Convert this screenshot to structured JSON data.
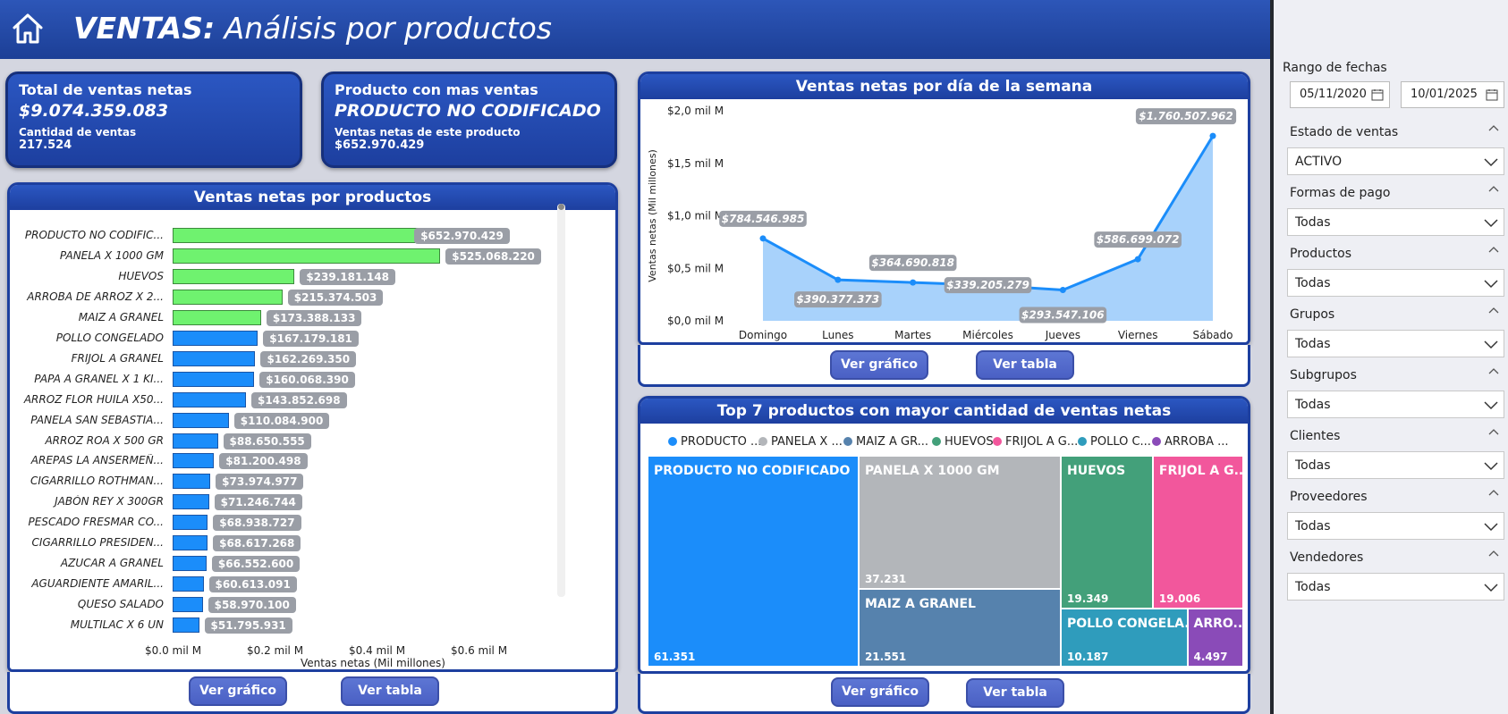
{
  "header": {
    "title_bold": "VENTAS:",
    "title_rest": " Análisis por productos"
  },
  "kpis": {
    "total": {
      "title": "Total de ventas netas",
      "value": "$9.074.359.083",
      "sub_label": "Cantidad de ventas",
      "sub_value": "217.524"
    },
    "top_product": {
      "title": "Producto con mas ventas",
      "value": "PRODUCTO NO CODIFICADO",
      "sub_label": "Ventas netas de este producto",
      "sub_value": "$652.970.429"
    }
  },
  "colors": {
    "header_blue": "#1d3f9f",
    "green": "#6ff26f",
    "blue": "#1b8dfa",
    "area": "#a8d2fb",
    "line": "#1b8dfa"
  },
  "product_panel": {
    "title": "Ventas netas por productos",
    "xlabel": "Ventas netas (Mil millones)",
    "ticks": [
      "$0.0 mil M",
      "$0.2 mil M",
      "$0.4 mil M",
      "$0.6 mil M"
    ],
    "buttons": [
      "Ver gráfico",
      "Ver tabla"
    ]
  },
  "chart_data": [
    {
      "type": "bar",
      "orientation": "horizontal",
      "title": "Ventas netas por productos",
      "xlabel": "Ventas netas (Mil millones)",
      "xlim": [
        0,
        0.6
      ],
      "categories": [
        "PRODUCTO NO CODIFIC...",
        "PANELA X 1000 GM",
        "HUEVOS",
        "ARROBA DE ARROZ X 2...",
        "MAIZ A GRANEL",
        "POLLO CONGELADO",
        "FRIJOL A GRANEL",
        "PAPA A GRANEL X 1 KI...",
        "ARROZ FLOR HUILA X50...",
        "PANELA SAN SEBASTIA...",
        "ARROZ ROA X 500 GR",
        "AREPAS LA ANSERMEÑ...",
        "CIGARRILLO ROTHMAN...",
        "JABÓN REY X 300GR",
        "PESCADO FRESMAR CO...",
        "CIGARRILLO PRESIDEN...",
        "AZUCAR A GRANEL",
        "AGUARDIENTE AMARIL...",
        "QUESO SALADO",
        "MULTILAC X 6 UN"
      ],
      "values": [
        652970429,
        525068220,
        239181148,
        215374503,
        173388133,
        167179181,
        162269350,
        160068390,
        143852698,
        110084900,
        88650555,
        81200498,
        73974977,
        71246744,
        68938727,
        68617268,
        66552600,
        60613091,
        58970100,
        51795931
      ],
      "value_labels": [
        "$652.970.429",
        "$525.068.220",
        "$239.181.148",
        "$215.374.503",
        "$173.388.133",
        "$167.179.181",
        "$162.269.350",
        "$160.068.390",
        "$143.852.698",
        "$110.084.900",
        "$88.650.555",
        "$81.200.498",
        "$73.974.977",
        "$71.246.744",
        "$68.938.727",
        "$68.617.268",
        "$66.552.600",
        "$60.613.091",
        "$58.970.100",
        "$51.795.931"
      ],
      "highlight_count": 5
    },
    {
      "type": "area",
      "title": "Ventas netas por día de la semana",
      "ylabel": "Ventas netas (Mil millones)",
      "ylim": [
        0,
        2.0
      ],
      "categories": [
        "Domingo",
        "Lunes",
        "Martes",
        "Miércoles",
        "Jueves",
        "Viernes",
        "Sábado"
      ],
      "values": [
        784546985,
        390377373,
        364690818,
        339205279,
        293547106,
        586699072,
        1760507962
      ],
      "value_labels": [
        "$784.546.985",
        "$390.377.373",
        "$364.690.818",
        "$339.205.279",
        "$293.547.106",
        "$586.699.072",
        "$1.760.507.962"
      ],
      "y_ticks": [
        "$2,0 mil M",
        "$1,5 mil M",
        "$1,0 mil M",
        "$0,5 mil M",
        "$0,0 mil M"
      ]
    },
    {
      "type": "treemap",
      "title": "Top 7 productos con mayor cantidad de ventas netas",
      "legend": [
        "PRODUCTO ...",
        "PANELA X ...",
        "MAIZ A GR...",
        "HUEVOS",
        "FRIJOL A G...",
        "POLLO C...",
        "ARROBA ..."
      ],
      "items": [
        {
          "name": "PRODUCTO NO CODIFICADO",
          "value": 61351,
          "label": "61.351",
          "color": "#1b8dfa"
        },
        {
          "name": "PANELA X 1000 GM",
          "value": 37231,
          "label": "37.231",
          "color": "#b3b6ba"
        },
        {
          "name": "MAIZ A GRANEL",
          "value": 21551,
          "label": "21.551",
          "color": "#5682ad"
        },
        {
          "name": "HUEVOS",
          "value": 19349,
          "label": "19.349",
          "color": "#43a07a"
        },
        {
          "name": "FRIJOL A G...",
          "value": 19006,
          "label": "19.006",
          "color": "#f2579c"
        },
        {
          "name": "POLLO CONGELA...",
          "value": 10187,
          "label": "10.187",
          "color": "#2f9cbc"
        },
        {
          "name": "ARRO...",
          "value": 4497,
          "label": "4.497",
          "color": "#8a4bb8"
        }
      ]
    }
  ],
  "week_panel": {
    "title": "Ventas netas por día de la semana",
    "buttons": [
      "Ver gráfico",
      "Ver tabla"
    ]
  },
  "top_panel": {
    "title": "Top 7 productos con mayor cantidad de ventas netas",
    "buttons": [
      "Ver gráfico",
      "Ver tabla"
    ]
  },
  "sidebar": {
    "date_title": "Rango de fechas",
    "date_from": "05/11/2020",
    "date_to": "10/01/2025",
    "slicers": [
      {
        "label": "Estado de ventas",
        "value": "ACTIVO"
      },
      {
        "label": "Formas de pago",
        "value": "Todas"
      },
      {
        "label": "Productos",
        "value": "Todas"
      },
      {
        "label": "Grupos",
        "value": "Todas"
      },
      {
        "label": "Subgrupos",
        "value": "Todas"
      },
      {
        "label": "Clientes",
        "value": "Todas"
      },
      {
        "label": "Proveedores",
        "value": "Todas"
      },
      {
        "label": "Vendedores",
        "value": "Todas"
      }
    ]
  }
}
